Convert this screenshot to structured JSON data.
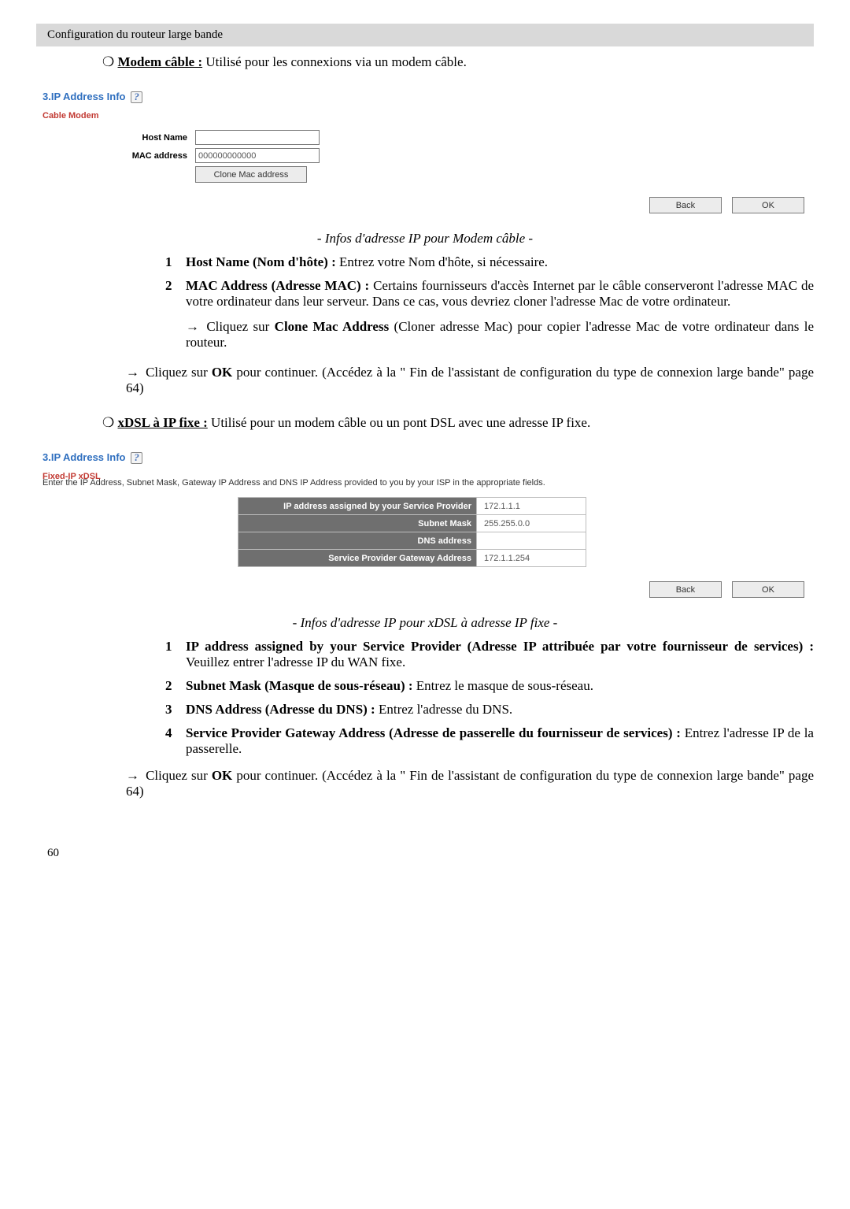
{
  "header": {
    "text": "Configuration du routeur large bande"
  },
  "sec_modem": {
    "bullet_label": "Modem câble :",
    "bullet_rest": " Utilisé pour les connexions via un modem câble."
  },
  "shot1": {
    "title": "3.IP Address Info",
    "section": "Cable Modem",
    "host_label": "Host Name",
    "mac_label": "MAC address",
    "mac_value": "000000000000",
    "clone_btn": "Clone Mac address",
    "back": "Back",
    "ok": "OK"
  },
  "cap1": "- Infos d'adresse IP pour Modem câble -",
  "list1": [
    {
      "n": "1",
      "b": "Host Name (Nom d'hôte) : ",
      "t": "Entrez votre Nom d'hôte, si nécessaire."
    },
    {
      "n": "2",
      "b": "MAC Address (Adresse MAC) : ",
      "t": "Certains fournisseurs d'accès Internet par le câble conserveront l'adresse MAC de votre ordinateur dans leur serveur. Dans ce cas, vous devriez cloner l'adresse Mac de votre ordinateur."
    }
  ],
  "clone_tip_pre": "Cliquez sur ",
  "clone_tip_b": "Clone Mac Address",
  "clone_tip_post": " (Cloner adresse Mac) pour copier l'adresse Mac de votre ordinateur dans le routeur.",
  "ok_tip_pre": "Cliquez sur ",
  "ok_tip_b": "OK",
  "ok_tip_post": " pour continuer. (Accédez à la \" Fin de l'assistant de configuration du type de connexion large bande\" page 64)",
  "sec_xdsl": {
    "bullet_label": "xDSL à IP fixe :",
    "bullet_rest": " Utilisé pour un modem câble ou un pont DSL avec une adresse IP fixe."
  },
  "shot2": {
    "title": "3.IP Address Info",
    "section": "Fixed-IP xDSL",
    "desc": "Enter the IP Address, Subnet Mask, Gateway IP Address and DNS IP Address provided to you by your ISP in the appropriate fields.",
    "rows": [
      {
        "lab": "IP address assigned by your Service Provider",
        "val": "172.1.1.1"
      },
      {
        "lab": "Subnet Mask",
        "val": "255.255.0.0"
      },
      {
        "lab": "DNS address",
        "val": ""
      },
      {
        "lab": "Service Provider Gateway Address",
        "val": "172.1.1.254"
      }
    ],
    "back": "Back",
    "ok": "OK"
  },
  "cap2": "- Infos d'adresse IP pour xDSL à adresse IP fixe -",
  "list2": [
    {
      "n": "1",
      "b": "IP address assigned by your Service Provider (Adresse IP attribuée par votre fournisseur de services) : ",
      "t": "Veuillez entrer l'adresse IP du WAN fixe."
    },
    {
      "n": "2",
      "b": "Subnet Mask (Masque de sous-réseau) : ",
      "t": "Entrez le masque de sous-réseau."
    },
    {
      "n": "3",
      "b": "DNS Address (Adresse du DNS) : ",
      "t": "Entrez l'adresse du DNS."
    },
    {
      "n": "4",
      "b": "Service Provider Gateway Address (Adresse de passerelle du fournisseur de services) : ",
      "t": "Entrez l'adresse IP de la passerelle."
    }
  ],
  "pagenum": "60"
}
